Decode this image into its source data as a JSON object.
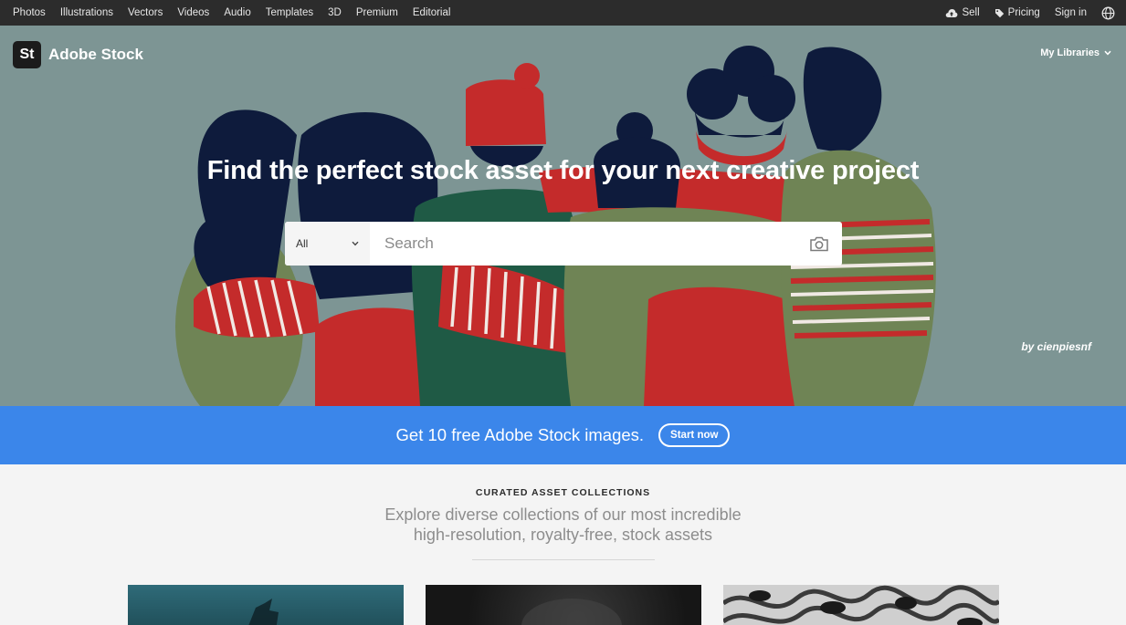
{
  "top_nav": {
    "links": [
      "Photos",
      "Illustrations",
      "Vectors",
      "Videos",
      "Audio",
      "Templates",
      "3D",
      "Premium",
      "Editorial"
    ],
    "sell": "Sell",
    "pricing": "Pricing",
    "sign_in": "Sign in"
  },
  "header": {
    "logo": "St",
    "brand": "Adobe Stock",
    "my_libraries": "My Libraries"
  },
  "hero": {
    "headline": "Find the perfect stock asset for your next creative project",
    "search": {
      "scope": "All",
      "placeholder": "Search"
    },
    "credit": "by cienpiesnf"
  },
  "promo": {
    "text": "Get 10 free Adobe Stock images.",
    "button": "Start now"
  },
  "collections": {
    "eyebrow": "CURATED ASSET COLLECTIONS",
    "subtitle_line1": "Explore diverse collections of our most incredible",
    "subtitle_line2": "high-resolution, royalty-free, stock assets"
  },
  "colors": {
    "top_nav_bg": "#2c2c2c",
    "hero_bg": "#7d9594",
    "promo_bg": "#3b86ea",
    "illustration_red": "#c42b2b",
    "illustration_navy": "#0e1b3c",
    "illustration_green": "#6f8455"
  }
}
